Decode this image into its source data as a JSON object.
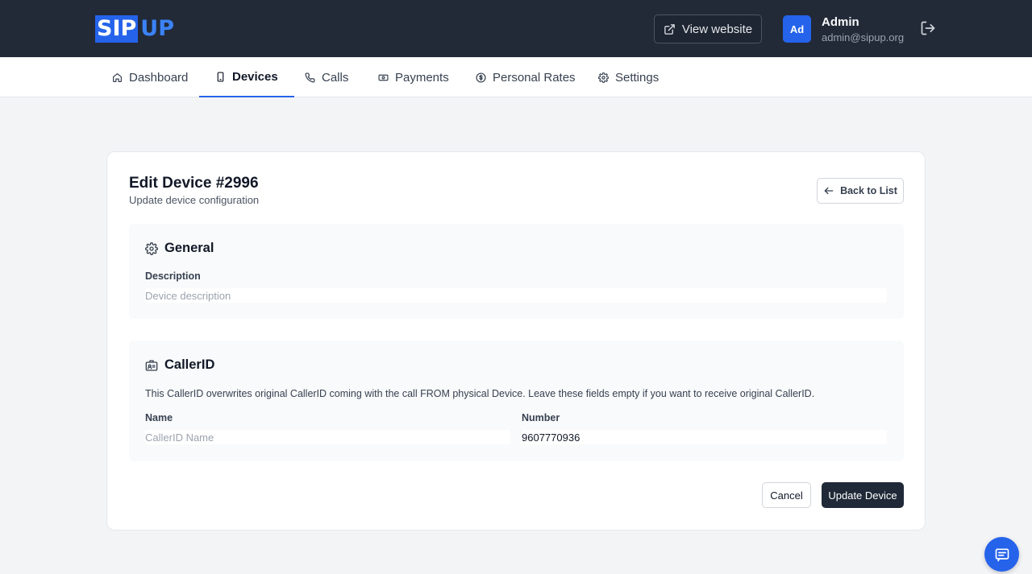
{
  "header": {
    "logo_left": "SIP",
    "logo_right": "UP",
    "view_website_label": "View website",
    "avatar_initials": "Ad",
    "user_name": "Admin",
    "user_email": "admin@sipup.org"
  },
  "nav": {
    "items": [
      {
        "label": "Dashboard",
        "icon": "home-icon"
      },
      {
        "label": "Devices",
        "icon": "phone-device-icon",
        "active": true
      },
      {
        "label": "Calls",
        "icon": "phone-icon"
      },
      {
        "label": "Payments",
        "icon": "money-icon"
      },
      {
        "label": "Personal Rates",
        "icon": "dollar-circle-icon"
      },
      {
        "label": "Settings",
        "icon": "gear-icon"
      }
    ]
  },
  "page": {
    "title": "Edit Device #2996",
    "subtitle": "Update device configuration",
    "back_label": "Back to List"
  },
  "general": {
    "heading": "General",
    "description_label": "Description",
    "description_placeholder": "Device description",
    "description_value": ""
  },
  "callerid": {
    "heading": "CallerID",
    "note": "This CallerID overwrites original CallerID coming with the call FROM physical Device. Leave these fields empty if you want to receive original CallerID.",
    "name_label": "Name",
    "name_placeholder": "CallerID Name",
    "name_value": "",
    "number_label": "Number",
    "number_value": "9607770936"
  },
  "actions": {
    "cancel_label": "Cancel",
    "update_label": "Update Device"
  },
  "colors": {
    "topbar": "#222a38",
    "accent": "#2563eb",
    "primary_button": "#1f2937"
  }
}
